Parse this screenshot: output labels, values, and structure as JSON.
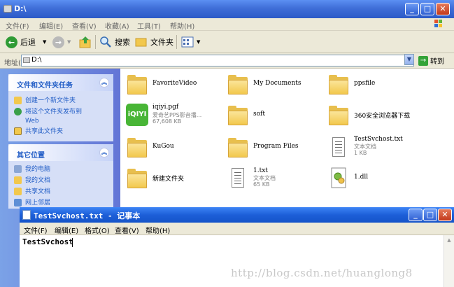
{
  "explorer": {
    "title": "D:\\",
    "menu": [
      "文件(F)",
      "编辑(E)",
      "查看(V)",
      "收藏(A)",
      "工具(T)",
      "帮助(H)"
    ],
    "toolbar": {
      "back": "后退",
      "search": "搜索",
      "folders": "文件夹"
    },
    "address": {
      "label": "地址(D)",
      "value": "D:\\",
      "go": "转到"
    },
    "tasks": {
      "title": "文件和文件夹任务",
      "items": [
        "创建一个新文件夹",
        "将这个文件夹发布到",
        "Web",
        "共享此文件夹"
      ]
    },
    "places": {
      "title": "其它位置",
      "items": [
        "我的电脑",
        "我的文档",
        "共享文档",
        "网上邻居"
      ]
    },
    "files": [
      {
        "name": "FavoriteVideo",
        "type": "folder"
      },
      {
        "name": "My Documents",
        "type": "folder"
      },
      {
        "name": "ppsfile",
        "type": "folder"
      },
      {
        "name": "iqiyi.pgf",
        "type": "iqiyi",
        "meta1": "爱奇艺PPS影音播...",
        "meta2": "67,608 KB"
      },
      {
        "name": "soft",
        "type": "folder"
      },
      {
        "name": "360安全浏览器下载",
        "type": "folder"
      },
      {
        "name": "KuGou",
        "type": "folder"
      },
      {
        "name": "Program Files",
        "type": "folder"
      },
      {
        "name": "TestSvchost.txt",
        "type": "text",
        "meta1": "文本文档",
        "meta2": "1 KB"
      },
      {
        "name": "新建文件夹",
        "type": "folder"
      },
      {
        "name": "1.txt",
        "type": "text",
        "meta1": "文本文档",
        "meta2": "65 KB"
      },
      {
        "name": "1.dll",
        "type": "dll"
      }
    ]
  },
  "notepad": {
    "title": "TestSvchost.txt - 记事本",
    "menu": [
      "文件(F)",
      "编辑(E)",
      "格式(O)",
      "查看(V)",
      "帮助(H)"
    ],
    "content": "TestSvchost"
  },
  "watermark": "http://blog.csdn.net/huanglong8",
  "colors": {
    "titlebar": "#3f6ed8",
    "taskpane": "#6f8ddb",
    "link": "#215dc6",
    "folder": "#f2c84d"
  }
}
